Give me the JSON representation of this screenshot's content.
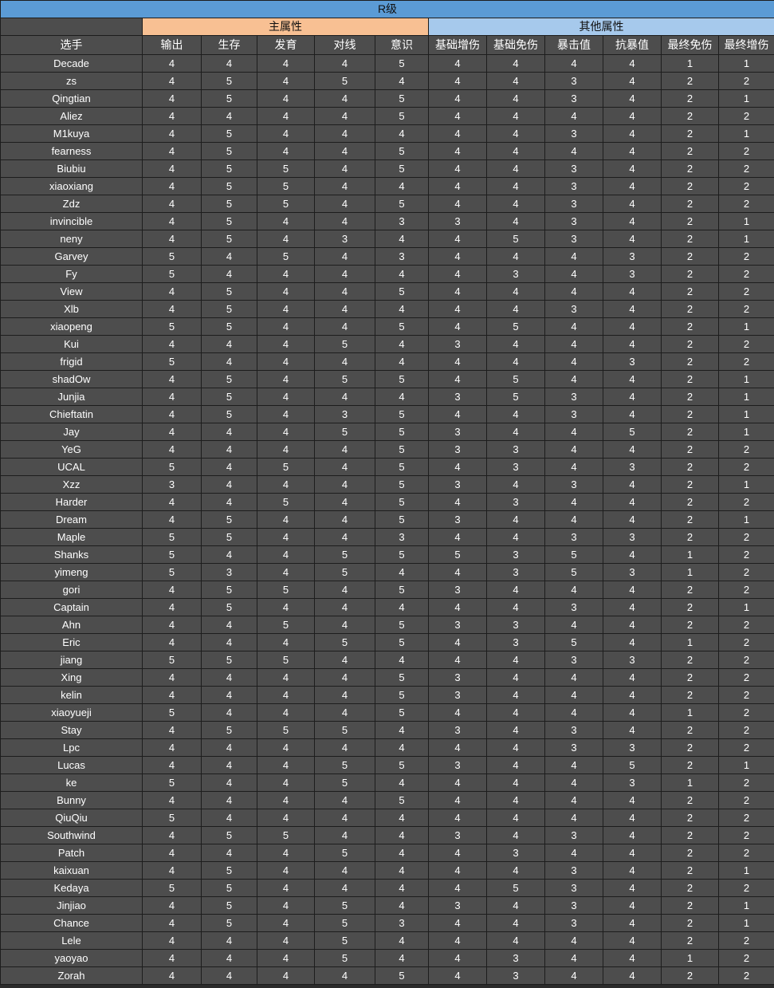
{
  "title": "R级",
  "groups": {
    "blank_label": "",
    "main_label": "主属性",
    "other_label": "其他属性"
  },
  "columns": [
    "选手",
    "输出",
    "生存",
    "发育",
    "对线",
    "意识",
    "基础增伤",
    "基础免伤",
    "暴击值",
    "抗暴值",
    "最终免伤",
    "最终增伤"
  ],
  "colors": {
    "title_bg": "#5b9bd5",
    "main_group_bg": "#f8c093",
    "other_group_bg": "#a6c9ec",
    "cell_bg": "#4d4d4d",
    "grid": "#1d1d1d",
    "text": "#ffffff"
  },
  "rows": [
    [
      "Decade",
      "4",
      "4",
      "4",
      "4",
      "5",
      "4",
      "4",
      "4",
      "4",
      "1",
      "1"
    ],
    [
      "zs",
      "4",
      "5",
      "4",
      "5",
      "4",
      "4",
      "4",
      "3",
      "4",
      "2",
      "2"
    ],
    [
      "Qingtian",
      "4",
      "5",
      "4",
      "4",
      "5",
      "4",
      "4",
      "3",
      "4",
      "2",
      "1"
    ],
    [
      "Aliez",
      "4",
      "4",
      "4",
      "4",
      "5",
      "4",
      "4",
      "4",
      "4",
      "2",
      "2"
    ],
    [
      "M1kuya",
      "4",
      "5",
      "4",
      "4",
      "4",
      "4",
      "4",
      "3",
      "4",
      "2",
      "1"
    ],
    [
      "fearness",
      "4",
      "5",
      "4",
      "4",
      "5",
      "4",
      "4",
      "4",
      "4",
      "2",
      "2"
    ],
    [
      "Biubiu",
      "4",
      "5",
      "5",
      "4",
      "5",
      "4",
      "4",
      "3",
      "4",
      "2",
      "2"
    ],
    [
      "xiaoxiang",
      "4",
      "5",
      "5",
      "4",
      "4",
      "4",
      "4",
      "3",
      "4",
      "2",
      "2"
    ],
    [
      "Zdz",
      "4",
      "5",
      "5",
      "4",
      "5",
      "4",
      "4",
      "3",
      "4",
      "2",
      "2"
    ],
    [
      "invincible",
      "4",
      "5",
      "4",
      "4",
      "3",
      "3",
      "4",
      "3",
      "4",
      "2",
      "1"
    ],
    [
      "neny",
      "4",
      "5",
      "4",
      "3",
      "4",
      "4",
      "5",
      "3",
      "4",
      "2",
      "1"
    ],
    [
      "Garvey",
      "5",
      "4",
      "5",
      "4",
      "3",
      "4",
      "4",
      "4",
      "3",
      "2",
      "2"
    ],
    [
      "Fy",
      "5",
      "4",
      "4",
      "4",
      "4",
      "4",
      "3",
      "4",
      "3",
      "2",
      "2"
    ],
    [
      "View",
      "4",
      "5",
      "4",
      "4",
      "5",
      "4",
      "4",
      "4",
      "4",
      "2",
      "2"
    ],
    [
      "Xlb",
      "4",
      "5",
      "4",
      "4",
      "4",
      "4",
      "4",
      "3",
      "4",
      "2",
      "2"
    ],
    [
      "xiaopeng",
      "5",
      "5",
      "4",
      "4",
      "5",
      "4",
      "5",
      "4",
      "4",
      "2",
      "1"
    ],
    [
      "Kui",
      "4",
      "4",
      "4",
      "5",
      "4",
      "3",
      "4",
      "4",
      "4",
      "2",
      "2"
    ],
    [
      "frigid",
      "5",
      "4",
      "4",
      "4",
      "4",
      "4",
      "4",
      "4",
      "3",
      "2",
      "2"
    ],
    [
      "shadOw",
      "4",
      "5",
      "4",
      "5",
      "5",
      "4",
      "5",
      "4",
      "4",
      "2",
      "1"
    ],
    [
      "Junjia",
      "4",
      "5",
      "4",
      "4",
      "4",
      "3",
      "5",
      "3",
      "4",
      "2",
      "1"
    ],
    [
      "Chieftatin",
      "4",
      "5",
      "4",
      "3",
      "5",
      "4",
      "4",
      "3",
      "4",
      "2",
      "1"
    ],
    [
      "Jay",
      "4",
      "4",
      "4",
      "5",
      "5",
      "3",
      "4",
      "4",
      "5",
      "2",
      "1"
    ],
    [
      "YeG",
      "4",
      "4",
      "4",
      "4",
      "5",
      "3",
      "3",
      "4",
      "4",
      "2",
      "2"
    ],
    [
      "UCAL",
      "5",
      "4",
      "5",
      "4",
      "5",
      "4",
      "3",
      "4",
      "3",
      "2",
      "2"
    ],
    [
      "Xzz",
      "3",
      "4",
      "4",
      "4",
      "5",
      "3",
      "4",
      "3",
      "4",
      "2",
      "1"
    ],
    [
      "Harder",
      "4",
      "4",
      "5",
      "4",
      "5",
      "4",
      "3",
      "4",
      "4",
      "2",
      "2"
    ],
    [
      "Dream",
      "4",
      "5",
      "4",
      "4",
      "5",
      "3",
      "4",
      "4",
      "4",
      "2",
      "1"
    ],
    [
      "Maple",
      "5",
      "5",
      "4",
      "4",
      "3",
      "4",
      "4",
      "3",
      "3",
      "2",
      "2"
    ],
    [
      "Shanks",
      "5",
      "4",
      "4",
      "5",
      "5",
      "5",
      "3",
      "5",
      "4",
      "1",
      "2"
    ],
    [
      "yimeng",
      "5",
      "3",
      "4",
      "5",
      "4",
      "4",
      "3",
      "5",
      "3",
      "1",
      "2"
    ],
    [
      "gori",
      "4",
      "5",
      "5",
      "4",
      "5",
      "3",
      "4",
      "4",
      "4",
      "2",
      "2"
    ],
    [
      "Captain",
      "4",
      "5",
      "4",
      "4",
      "4",
      "4",
      "4",
      "3",
      "4",
      "2",
      "1"
    ],
    [
      "Ahn",
      "4",
      "4",
      "5",
      "4",
      "5",
      "3",
      "3",
      "4",
      "4",
      "2",
      "2"
    ],
    [
      "Eric",
      "4",
      "4",
      "4",
      "5",
      "5",
      "4",
      "3",
      "5",
      "4",
      "1",
      "2"
    ],
    [
      "jiang",
      "5",
      "5",
      "5",
      "4",
      "4",
      "4",
      "4",
      "3",
      "3",
      "2",
      "2"
    ],
    [
      "Xing",
      "4",
      "4",
      "4",
      "4",
      "5",
      "3",
      "4",
      "4",
      "4",
      "2",
      "2"
    ],
    [
      "kelin",
      "4",
      "4",
      "4",
      "4",
      "5",
      "3",
      "4",
      "4",
      "4",
      "2",
      "2"
    ],
    [
      "xiaoyueji",
      "5",
      "4",
      "4",
      "4",
      "5",
      "4",
      "4",
      "4",
      "4",
      "1",
      "2"
    ],
    [
      "Stay",
      "4",
      "5",
      "5",
      "5",
      "4",
      "3",
      "4",
      "3",
      "4",
      "2",
      "2"
    ],
    [
      "Lpc",
      "4",
      "4",
      "4",
      "4",
      "4",
      "4",
      "4",
      "3",
      "3",
      "2",
      "2"
    ],
    [
      "Lucas",
      "4",
      "4",
      "4",
      "5",
      "5",
      "3",
      "4",
      "4",
      "5",
      "2",
      "1"
    ],
    [
      "ke",
      "5",
      "4",
      "4",
      "5",
      "4",
      "4",
      "4",
      "4",
      "3",
      "1",
      "2"
    ],
    [
      "Bunny",
      "4",
      "4",
      "4",
      "4",
      "5",
      "4",
      "4",
      "4",
      "4",
      "2",
      "2"
    ],
    [
      "QiuQiu",
      "5",
      "4",
      "4",
      "4",
      "4",
      "4",
      "4",
      "4",
      "4",
      "2",
      "2"
    ],
    [
      "Southwind",
      "4",
      "5",
      "5",
      "4",
      "4",
      "3",
      "4",
      "3",
      "4",
      "2",
      "2"
    ],
    [
      "Patch",
      "4",
      "4",
      "4",
      "5",
      "4",
      "4",
      "3",
      "4",
      "4",
      "2",
      "2"
    ],
    [
      "kaixuan",
      "4",
      "5",
      "4",
      "4",
      "4",
      "4",
      "4",
      "3",
      "4",
      "2",
      "1"
    ],
    [
      "Kedaya",
      "5",
      "5",
      "4",
      "4",
      "4",
      "4",
      "5",
      "3",
      "4",
      "2",
      "2"
    ],
    [
      "Jinjiao",
      "4",
      "5",
      "4",
      "5",
      "4",
      "3",
      "4",
      "3",
      "4",
      "2",
      "1"
    ],
    [
      "Chance",
      "4",
      "5",
      "4",
      "5",
      "3",
      "4",
      "4",
      "3",
      "4",
      "2",
      "1"
    ],
    [
      "Lele",
      "4",
      "4",
      "4",
      "5",
      "4",
      "4",
      "4",
      "4",
      "4",
      "2",
      "2"
    ],
    [
      "yaoyao",
      "4",
      "4",
      "4",
      "5",
      "4",
      "4",
      "3",
      "4",
      "4",
      "1",
      "2"
    ],
    [
      "Zorah",
      "4",
      "4",
      "4",
      "4",
      "5",
      "4",
      "3",
      "4",
      "4",
      "2",
      "2"
    ]
  ]
}
